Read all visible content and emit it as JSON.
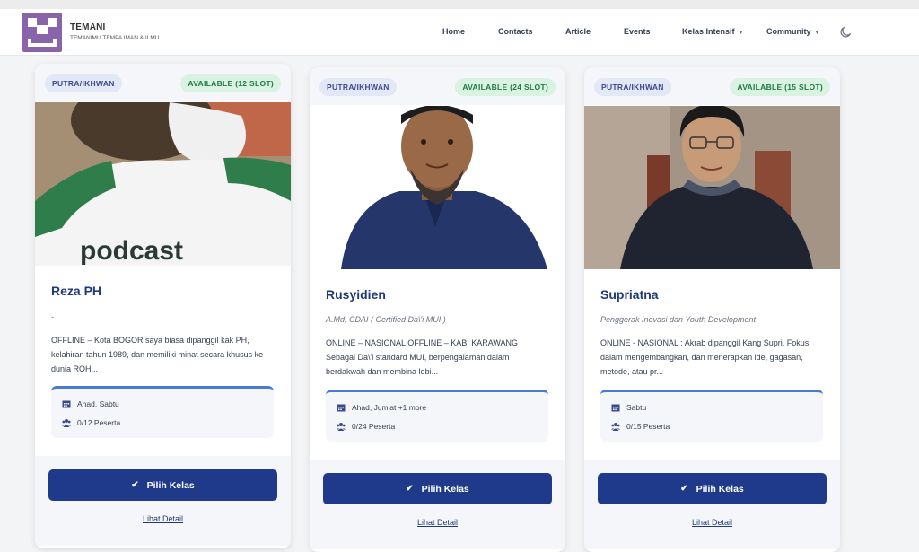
{
  "brand": {
    "name": "TEMANI",
    "tagline": "TEMANIMU TEMPA IMAN & ILMU"
  },
  "nav": {
    "home": "Home",
    "contacts": "Contacts",
    "article": "Article",
    "events": "Events",
    "kelas": "Kelas Intensif",
    "community": "Community"
  },
  "colors": {
    "accent": "#1f3a8a",
    "brand": "#8a64a8",
    "available": "#1f7a43"
  },
  "cards": [
    {
      "category": "PUTRA/IKHWAN",
      "availability": "AVAILABLE (12 SLOT)",
      "name": "Reza PH",
      "title": "-",
      "description": "OFFLINE – Kota BOGOR saya biasa dipanggil kak PH, kelahiran tahun 1989, dan memiliki minat secara khusus ke dunia ROH...",
      "days": "Ahad, Sabtu",
      "participants": "0/12 Peserta",
      "button": "Pilih Kelas",
      "detail": "Lihat Detail"
    },
    {
      "category": "PUTRA/IKHWAN",
      "availability": "AVAILABLE (24 SLOT)",
      "name": "Rusyidien",
      "title": "A.Md, CDAI ( Certified Da\\'i MUI )",
      "description": "ONLINE – NASIONAL OFFLINE – KAB. KARAWANG Sebagai Da\\'i standard MUI, berpengalaman dalam berdakwah dan membina lebi...",
      "days": "Ahad, Jum'at +1 more",
      "participants": "0/24 Peserta",
      "button": "Pilih Kelas",
      "detail": "Lihat Detail"
    },
    {
      "category": "PUTRA/IKHWAN",
      "availability": "AVAILABLE (15 SLOT)",
      "name": "Supriatna",
      "title": "Penggerak Inovasi dan Youth Development",
      "description": "ONLINE - NASIONAL : Akrab dipanggil Kang Supri. Fokus dalam mengembangkan, dan menerapkan ide, gagasan, metode, atau pr...",
      "days": "Sabtu",
      "participants": "0/15 Peserta",
      "button": "Pilih Kelas",
      "detail": "Lihat Detail"
    }
  ]
}
